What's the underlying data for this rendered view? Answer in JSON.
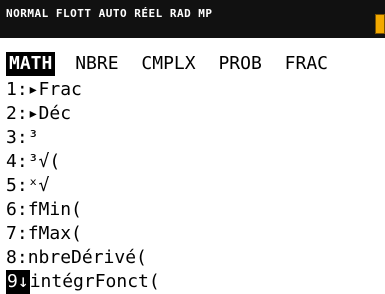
{
  "status_bar": {
    "text": "NORMAL FLOTT AUTO RÉEL RAD MP",
    "battery_color": "#f2a900"
  },
  "tabs": [
    {
      "label": "MATH",
      "active": true
    },
    {
      "label": "NBRE",
      "active": false
    },
    {
      "label": "CMPLX",
      "active": false
    },
    {
      "label": "PROB",
      "active": false
    },
    {
      "label": "FRAC",
      "active": false
    }
  ],
  "menu": {
    "items": [
      {
        "num": "1:",
        "label": "▸Frac"
      },
      {
        "num": "2:",
        "label": "▸Déc"
      },
      {
        "num": "3:",
        "label": "³"
      },
      {
        "num": "4:",
        "label": "³√("
      },
      {
        "num": "5:",
        "label": "ˣ√"
      },
      {
        "num": "6:",
        "label": "fMin("
      },
      {
        "num": "7:",
        "label": "fMax("
      },
      {
        "num": "8:",
        "label": "nbreDérivé("
      },
      {
        "num": "9↓",
        "label": "intégrFonct(",
        "highlighted": true
      }
    ]
  }
}
